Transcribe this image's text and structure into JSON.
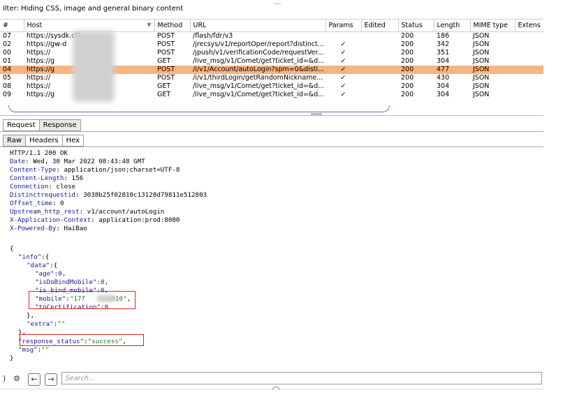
{
  "filter": {
    "text": "ilter: Hiding CSS, image and general binary content"
  },
  "table": {
    "columns": [
      "#",
      "Host",
      "Method",
      "URL",
      "Params",
      "Edited",
      "Status",
      "Length",
      "MIME type",
      "Extens"
    ],
    "rows": [
      {
        "num": "07",
        "host": "https://sysdk.cl2",
        "method": "POST",
        "url": "/flash/fdr/v3",
        "params": "",
        "status": "200",
        "length": "186",
        "mime": "JSON"
      },
      {
        "num": "02",
        "host": "https://gw-d",
        "method": "POST",
        "url": "/jrecsys/v1/reportOper/report?distinct...",
        "params": "✓",
        "status": "200",
        "length": "342",
        "mime": "JSON"
      },
      {
        "num": "00",
        "host": "https://",
        "method": "POST",
        "url": "/jpush/v1/verificationCode/requestVer...",
        "params": "✓",
        "status": "200",
        "length": "351",
        "mime": "JSON"
      },
      {
        "num": "01",
        "host": "https://g",
        "method": "GET",
        "url": "/live_msg/v1/Comet/get?ticket_id=&d...",
        "params": "✓",
        "status": "200",
        "length": "304",
        "mime": "JSON"
      },
      {
        "num": "04",
        "host": "https://g",
        "method": "POST",
        "url": "/i/v1/Account/autoLogin?spm=0&disti...",
        "params": "✓",
        "status": "200",
        "length": "477",
        "mime": "JSON",
        "selected": true
      },
      {
        "num": "05",
        "host": "https://",
        "method": "POST",
        "url": "/i/v1/thirdLogin/getRandomNickname...",
        "params": "✓",
        "status": "200",
        "length": "430",
        "mime": "JSON"
      },
      {
        "num": "08",
        "host": "https://",
        "method": "GET",
        "url": "/live_msg/v1/Comet/get?ticket_id=&d...",
        "params": "✓",
        "status": "200",
        "length": "304",
        "mime": "JSON"
      },
      {
        "num": "09",
        "host": "https://g",
        "method": "GET",
        "url": "/live_msg/v1/Comet/get?ticket_id=&d...",
        "params": "✓",
        "status": "200",
        "length": "304",
        "mime": "JSON"
      }
    ]
  },
  "tabs_main": [
    {
      "label": "Request"
    },
    {
      "label": "Response"
    }
  ],
  "tabs_view": [
    {
      "label": "Raw"
    },
    {
      "label": "Headers"
    },
    {
      "label": "Hex"
    }
  ],
  "response": {
    "status_line": "HTTP/1.1 200 OK",
    "headers": [
      {
        "name": "Date",
        "value": "Wed, 30 Mar 2022 08:43:48 GMT"
      },
      {
        "name": "Content-Type",
        "value": "application/json;charset=UTF-8"
      },
      {
        "name": "Content-Length",
        "value": "156"
      },
      {
        "name": "Connection",
        "value": "close"
      },
      {
        "name": "Distinctrequestid",
        "value": "3038b25f02810c13128d79811e512803"
      },
      {
        "name": "Offset_time",
        "value": "0"
      },
      {
        "name": "Upstream_http_rest",
        "value": "v1/account/autoLogin"
      },
      {
        "name": "X-Application-Context",
        "value": "application:prod:8080"
      },
      {
        "name": "X-Powered-By",
        "value": "HaiBao"
      }
    ],
    "body": {
      "open": "{",
      "info_key": "\"info\"",
      "info_open": ":{",
      "data_key": "\"data\"",
      "data_open": ":{",
      "age_key": "\"age\"",
      "age_val": ":0,",
      "dobind_key": "\"isDoBindMobile\"",
      "dobind_val": ":0,",
      "isbind_key": "\"is_bind_mobile\"",
      "isbind_val": ":0,",
      "mobile_key": "\"mobile\"",
      "mobile_val": "\"177",
      "mobile_tail": "4010\"",
      "cert_key": "\"toCertification\"",
      "cert_val": ":0",
      "data_close": "},",
      "extra_key": "\"extra\"",
      "extra_val": "\"\"",
      "info_close": "},",
      "status_key": "response_status\"",
      "status_val": "\"success\"",
      "msg_key": "\"msg\"",
      "msg_val": "\"\"",
      "close": "}"
    }
  },
  "search": {
    "placeholder": "Search..."
  },
  "bottom_icons": [
    "help-icon",
    "settings-icon",
    "back-arrow-icon",
    "forward-arrow-icon"
  ]
}
